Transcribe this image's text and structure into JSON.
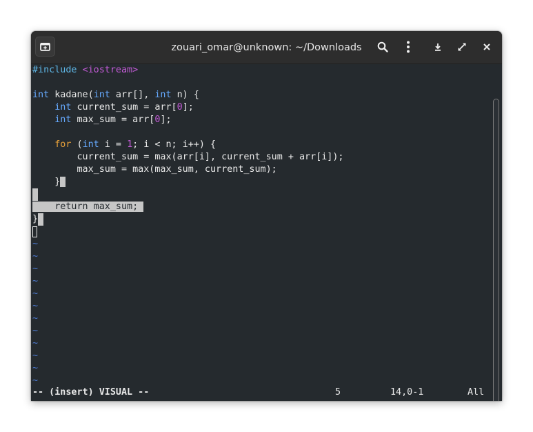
{
  "window": {
    "title": "zouari_omar@unknown: ~/Downloads"
  },
  "icons": {
    "new_tab": "new-tab-icon",
    "search": "search-icon",
    "menu": "kebab-menu-icon",
    "minimize": "minimize-icon",
    "maximize": "maximize-icon",
    "close": "close-icon"
  },
  "editor": {
    "code": {
      "l1_directive": "#include",
      "l1_header": "<iostream>",
      "l3_type1": "int",
      "l3_sig1": " kadane(",
      "l3_type2": "int",
      "l3_sig2": " arr[], ",
      "l3_type3": "int",
      "l3_sig3": " n) {",
      "l4_type": "int",
      "l4_a": " current_sum = arr[",
      "l4_idx": "0",
      "l4_b": "];",
      "l5_type": "int",
      "l5_a": " max_sum = arr[",
      "l5_idx": "0",
      "l5_b": "];",
      "l7_for": "for",
      "l7_a": " (",
      "l7_type": "int",
      "l7_b": " i = ",
      "l7_num": "1",
      "l7_c": "; i < n; i++) {",
      "l8": "current_sum = max(arr[i], current_sum + arr[i]);",
      "l9": "max_sum = max(max_sum, current_sum);",
      "l10": "}",
      "l12": "    return max_sum;",
      "l13": "}"
    },
    "tilde": "~"
  },
  "status": {
    "mode": "-- (insert) VISUAL --",
    "selection_count": "5",
    "position": "14,0-1",
    "scroll": "All"
  },
  "colors": {
    "terminal_bg": "#252a2e",
    "keyword": "#66aaff",
    "string": "#c25bd6",
    "selection": "#c6c6c6",
    "tilde": "#4d7bd4"
  }
}
